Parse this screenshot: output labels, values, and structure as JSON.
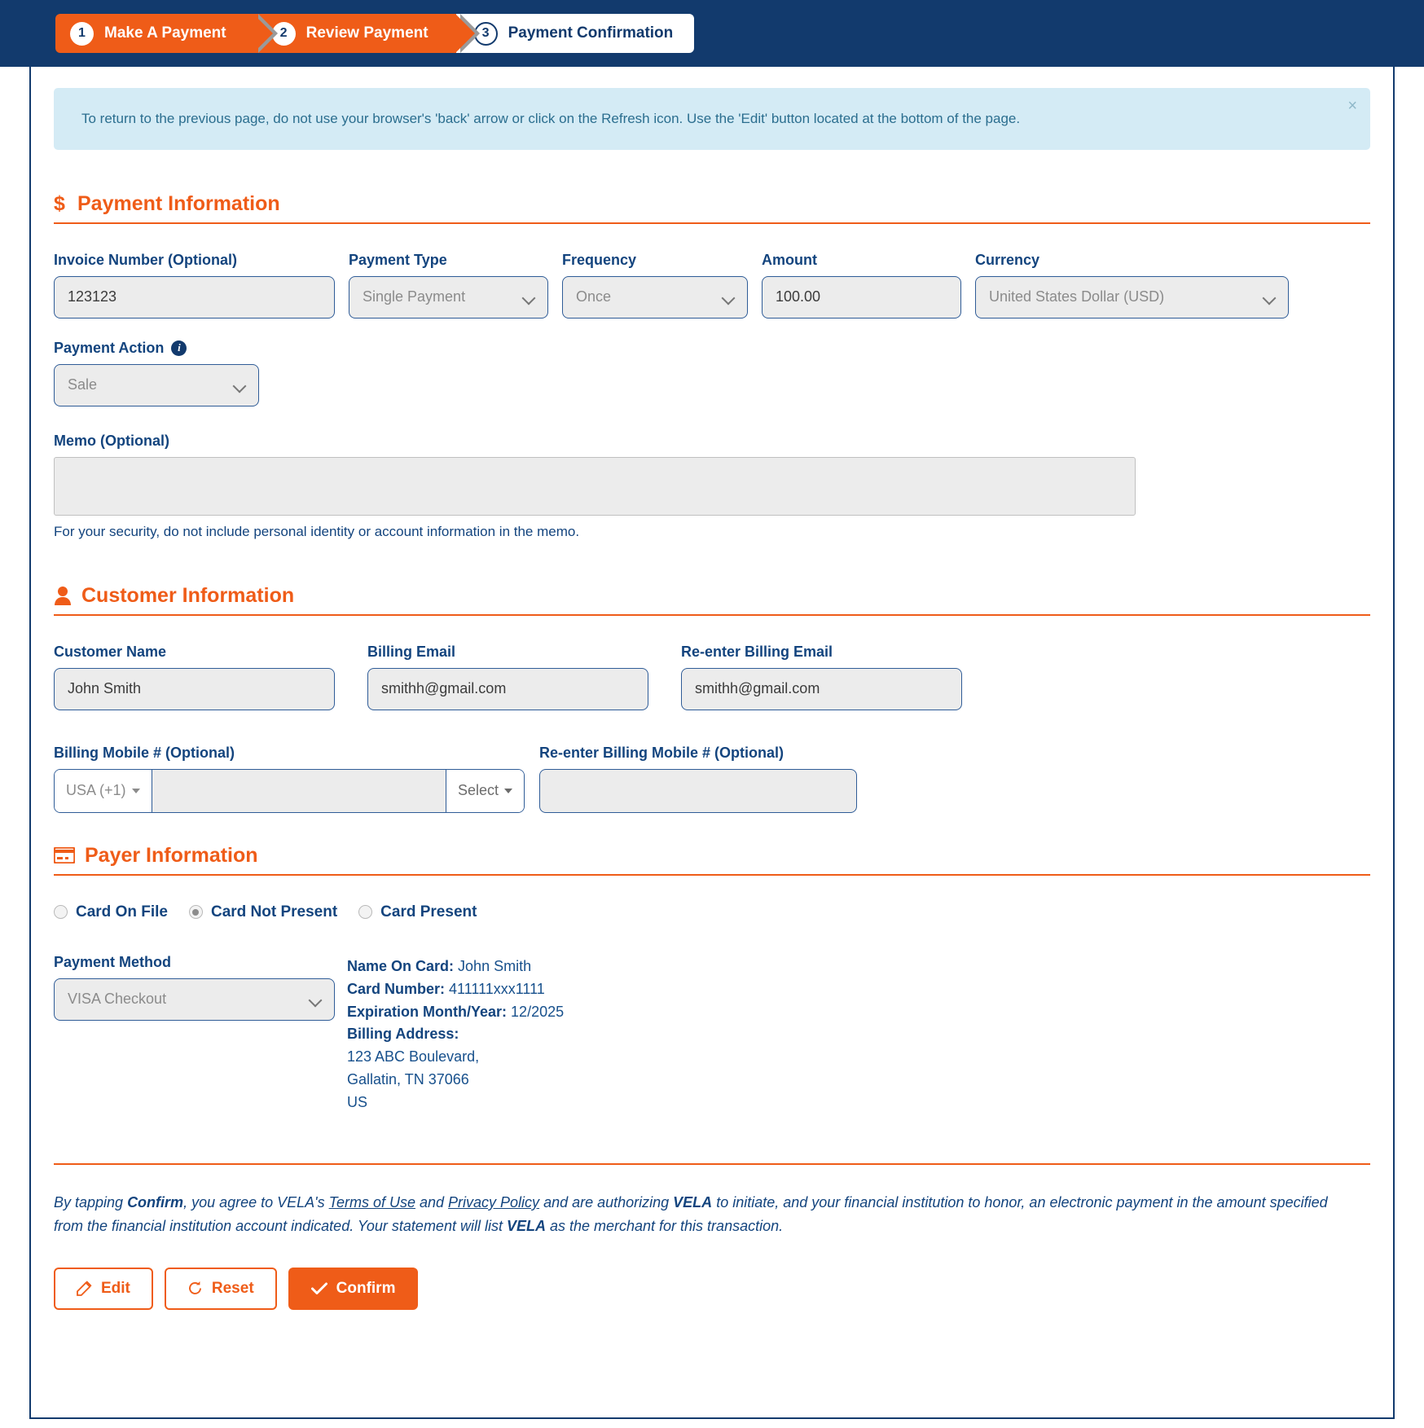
{
  "stepper": {
    "steps": [
      {
        "num": "1",
        "label": "Make A Payment"
      },
      {
        "num": "2",
        "label": "Review Payment"
      },
      {
        "num": "3",
        "label": "Payment Confirmation"
      }
    ]
  },
  "alert": {
    "text": "To return to the previous page, do not use your browser's 'back' arrow or click on the Refresh icon. Use the 'Edit' button located at the bottom of the page.",
    "close": "×"
  },
  "payment_information": {
    "heading": "Payment Information",
    "icon": "dollar-icon",
    "invoice_number": {
      "label": "Invoice Number (Optional)",
      "value": "123123"
    },
    "payment_type": {
      "label": "Payment Type",
      "value": "Single Payment"
    },
    "frequency": {
      "label": "Frequency",
      "value": "Once"
    },
    "amount": {
      "label": "Amount",
      "value": "100.00"
    },
    "currency": {
      "label": "Currency",
      "value": "United States Dollar (USD)"
    },
    "payment_action": {
      "label": "Payment Action",
      "value": "Sale",
      "info_icon": "info-icon"
    },
    "memo": {
      "label": "Memo (Optional)",
      "value": "",
      "hint": "For your security, do not include personal identity or account information in the memo."
    }
  },
  "customer_information": {
    "heading": "Customer Information",
    "icon": "person-icon",
    "customer_name": {
      "label": "Customer Name",
      "value": "John Smith"
    },
    "billing_email": {
      "label": "Billing Email",
      "value": "smithh@gmail.com"
    },
    "reenter_billing_email": {
      "label": "Re-enter Billing Email",
      "value": "smithh@gmail.com"
    },
    "billing_mobile": {
      "label": "Billing Mobile # (Optional)",
      "country_code": "USA (+1)",
      "value": "",
      "carrier_select": "Select"
    },
    "reenter_billing_mobile": {
      "label": "Re-enter Billing Mobile # (Optional)",
      "value": ""
    }
  },
  "payer_information": {
    "heading": "Payer Information",
    "icon": "credit-card-icon",
    "options": [
      {
        "label": "Card On File",
        "selected": false
      },
      {
        "label": "Card Not Present",
        "selected": true
      },
      {
        "label": "Card Present",
        "selected": false
      }
    ],
    "payment_method": {
      "label": "Payment Method",
      "value": "VISA Checkout"
    },
    "card_details": {
      "name_on_card_label": "Name On Card:",
      "name_on_card_value": "John Smith",
      "card_number_label": "Card Number:",
      "card_number_value": "411111xxx1111",
      "expiration_label": "Expiration Month/Year:",
      "expiration_value": "12/2025",
      "billing_address_label": "Billing Address:",
      "address_line1": "123 ABC Boulevard,",
      "address_line2": "Gallatin, TN 37066",
      "address_line3": "US"
    }
  },
  "legal": {
    "part1": "By tapping ",
    "confirm_word": "Confirm",
    "part2": ", you agree to VELA's ",
    "terms_link": "Terms of Use",
    "part3": " and ",
    "privacy_link": "Privacy Policy",
    "part4": " and are authorizing ",
    "vela1": "VELA",
    "part5": " to initiate, and your financial institution to honor, an electronic payment in the amount specified from the financial institution account indicated. Your statement will list ",
    "vela2": "VELA",
    "part6": " as the merchant for this transaction."
  },
  "buttons": {
    "edit": {
      "label": "Edit",
      "icon": "edit-pencil-icon"
    },
    "reset": {
      "label": "Reset",
      "icon": "refresh-icon"
    },
    "confirm": {
      "label": "Confirm",
      "icon": "check-icon"
    }
  },
  "colors": {
    "brand_orange": "#ef5c18",
    "brand_navy": "#123a6d",
    "alert_bg": "#d4ebf5",
    "field_bg": "#ececec"
  }
}
